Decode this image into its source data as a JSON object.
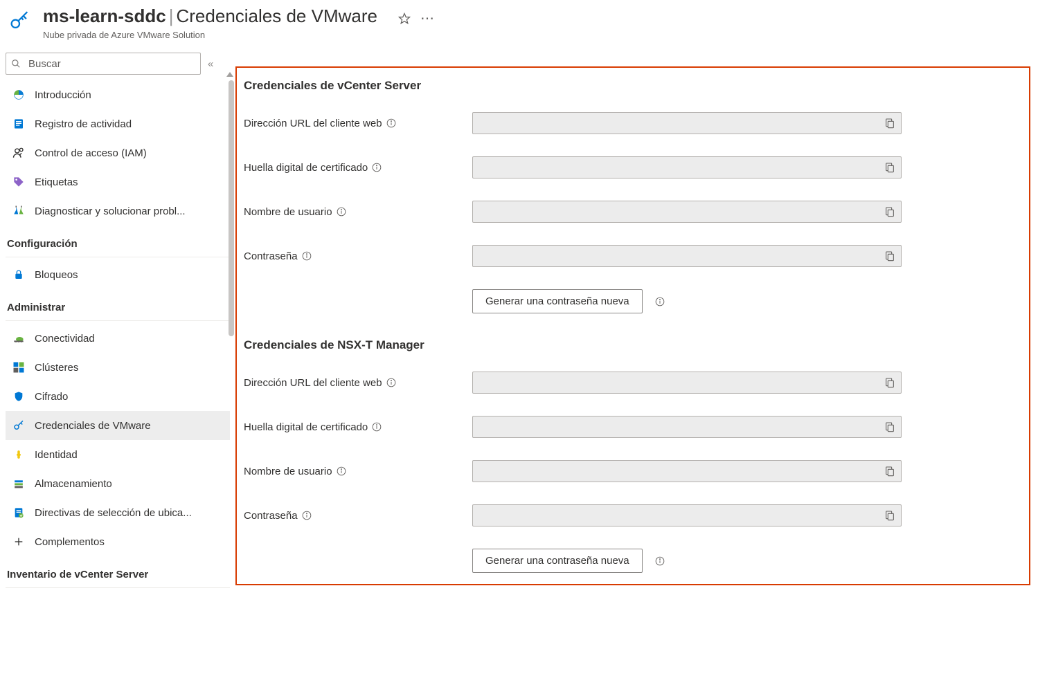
{
  "header": {
    "resource_name": "ms-learn-sddc",
    "separator": "|",
    "page_title": "Credenciales de VMware",
    "subtitle": "Nube privada de Azure VMware Solution"
  },
  "sidebar": {
    "search_placeholder": "Buscar",
    "collapse": "«",
    "items": [
      {
        "label": "Introducción"
      },
      {
        "label": "Registro de actividad"
      },
      {
        "label": "Control de acceso (IAM)"
      },
      {
        "label": "Etiquetas"
      },
      {
        "label": "Diagnosticar y solucionar probl..."
      }
    ],
    "group_config": {
      "header": "Configuración",
      "items": [
        {
          "label": "Bloqueos"
        }
      ]
    },
    "group_admin": {
      "header": "Administrar",
      "items": [
        {
          "label": "Conectividad"
        },
        {
          "label": "Clústeres"
        },
        {
          "label": "Cifrado"
        },
        {
          "label": "Credenciales de VMware",
          "selected": true
        },
        {
          "label": "Identidad"
        },
        {
          "label": "Almacenamiento"
        },
        {
          "label": "Directivas de selección de ubica..."
        },
        {
          "label": "Complementos"
        }
      ]
    },
    "group_inventory": {
      "header": "Inventario de vCenter Server"
    }
  },
  "content": {
    "vcenter": {
      "title": "Credenciales de vCenter Server",
      "fields": {
        "web_url": "Dirección URL del cliente web",
        "thumbprint": "Huella digital de certificado",
        "username": "Nombre de usuario",
        "password": "Contraseña"
      },
      "generate_btn": "Generar una contraseña nueva"
    },
    "nsxt": {
      "title": "Credenciales de NSX-T Manager",
      "fields": {
        "web_url": "Dirección URL del cliente web",
        "thumbprint": "Huella digital de certificado",
        "username": "Nombre de usuario",
        "password": "Contraseña"
      },
      "generate_btn": "Generar una contraseña nueva"
    }
  }
}
